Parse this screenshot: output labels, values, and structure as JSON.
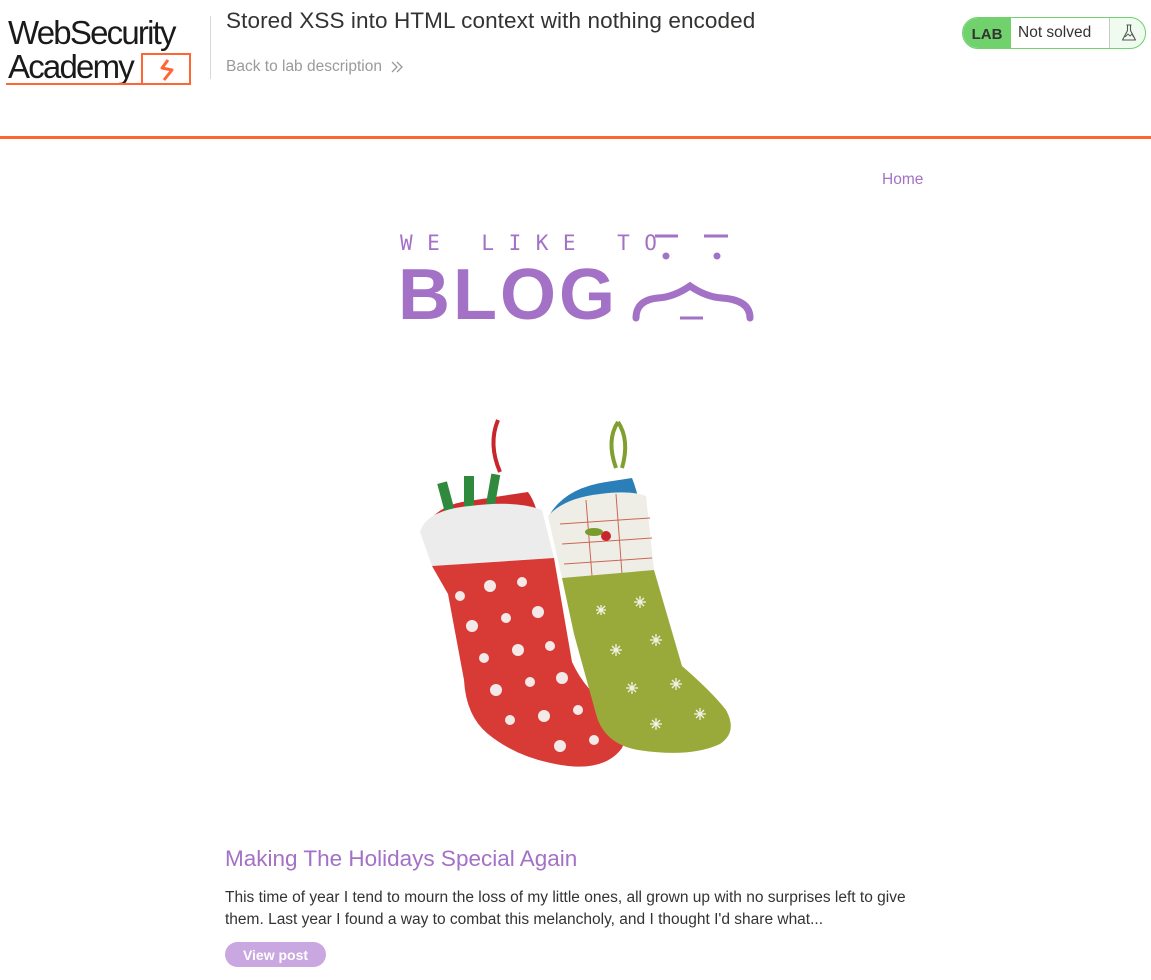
{
  "header": {
    "logo": {
      "line1": "WebSecurity",
      "line2": "Academy"
    },
    "lab_title": "Stored XSS into HTML context with nothing encoded",
    "back_link_label": "Back to lab description",
    "status": {
      "badge": "LAB",
      "text": "Not solved",
      "icon": "flask-icon"
    }
  },
  "nav": {
    "home_label": "Home"
  },
  "banner": {
    "tagline": "WE LIKE TO",
    "word": "BLOG"
  },
  "post": {
    "title": "Making The Holidays Special Again",
    "summary": "This time of year I tend to mourn the loss of my little ones, all grown up with no surprises left to give them. Last year I found a way to combat this melancholy, and I thought I'd share what...",
    "button_label": "View post",
    "image_alt": "red-and-green-christmas-stockings"
  },
  "colors": {
    "accent_orange": "#ff6633",
    "accent_purple": "#a371c6",
    "button_purple": "#c9a7e0",
    "lab_green": "#70d16d"
  }
}
